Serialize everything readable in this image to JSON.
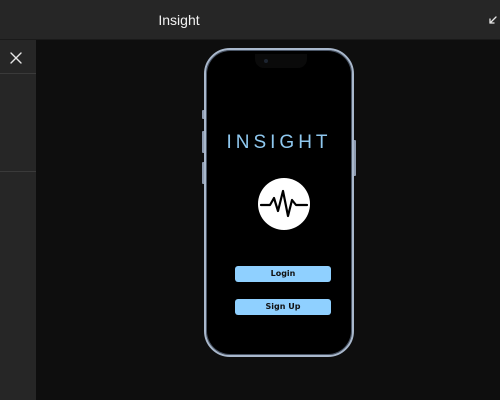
{
  "header": {
    "title": "Insight",
    "collapse_icon": "collapse-arrow-icon"
  },
  "sidebar": {
    "close_icon": "close-icon"
  },
  "app": {
    "title": "INSIGHT",
    "logo_icon": "heartbeat-pulse-icon",
    "login_label": "Login",
    "signup_label": "Sign Up"
  },
  "colors": {
    "accent": "#8fd0ff",
    "title": "#8fc8ef",
    "frame": "#a9b8cc",
    "panel": "#262626",
    "canvas": "#0e0e0e"
  }
}
